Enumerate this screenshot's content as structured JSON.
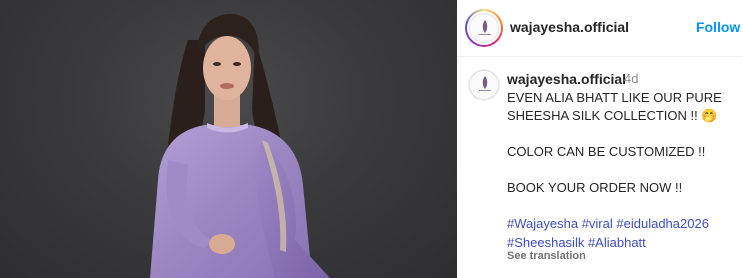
{
  "post": {
    "username": "wajayesha.official",
    "follow_label": "Follow"
  },
  "caption": {
    "username": "wajayesha.official",
    "timestamp": "4d",
    "line1": "EVEN ALIA BHATT LIKE OUR PURE SHEESHA SILK COLLECTION !! 🤭",
    "line2": "COLOR CAN BE CUSTOMIZED !!",
    "line3": "BOOK YOUR ORDER NOW !!",
    "hashtags": [
      "#Wajayesha",
      "#viral",
      "#eiduladha2026",
      "#Sheeshasilk",
      "#Aliabhatt"
    ],
    "see_translation": "See translation"
  },
  "colors": {
    "accent": "#0095f6",
    "hashtag": "#3c4ccd",
    "outfit": "#a58fc4",
    "background": "#3a3a3c"
  }
}
